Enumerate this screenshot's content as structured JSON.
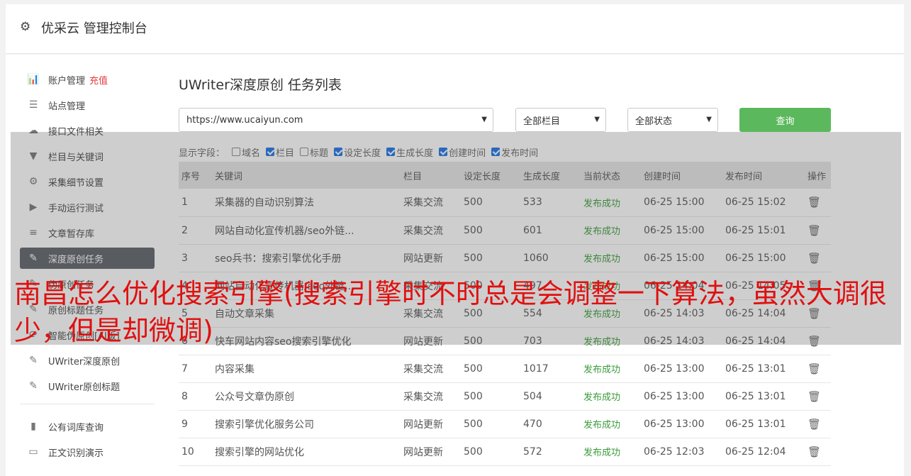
{
  "header": {
    "title": "优采云 管理控制台"
  },
  "sidebar": {
    "items": [
      {
        "label": "账户管理",
        "extra": "充值",
        "icon": "bar-chart-icon"
      },
      {
        "label": "站点管理",
        "icon": "server-icon"
      },
      {
        "label": "接口文件相关",
        "icon": "cloud-upload-icon"
      },
      {
        "label": "栏目与关键词",
        "icon": "filter-icon"
      },
      {
        "label": "采集细节设置",
        "icon": "cogs-icon"
      },
      {
        "label": "手动运行测试",
        "icon": "play-circle-icon"
      },
      {
        "label": "文章暂存库",
        "icon": "database-icon"
      },
      {
        "label": "深度原创任务",
        "icon": "edit-icon",
        "active": true
      },
      {
        "label": "伪原创任务",
        "icon": "edit-icon"
      },
      {
        "label": "原创标题任务",
        "icon": "edit-icon"
      },
      {
        "label": "智能伪原创[AI版]",
        "icon": "refresh-icon"
      },
      {
        "label": "UWriter深度原创",
        "icon": "edit-icon"
      },
      {
        "label": "UWriter原创标题",
        "icon": "edit-icon"
      }
    ],
    "bottom_items": [
      {
        "label": "公有词库查询",
        "icon": "book-icon"
      },
      {
        "label": "正文识别演示",
        "icon": "monitor-icon"
      }
    ]
  },
  "main": {
    "title": "UWriter深度原创 任务列表",
    "site_select": "https://www.ucaiyun.com",
    "column_select": "全部栏目",
    "status_select": "全部状态",
    "query_label": "查询",
    "fields_label": "显示字段：",
    "fields": [
      {
        "label": "域名",
        "checked": false
      },
      {
        "label": "栏目",
        "checked": true
      },
      {
        "label": "标题",
        "checked": false
      },
      {
        "label": "设定长度",
        "checked": true
      },
      {
        "label": "生成长度",
        "checked": true
      },
      {
        "label": "创建时间",
        "checked": true
      },
      {
        "label": "发布时间",
        "checked": true
      }
    ],
    "table": {
      "headers": [
        "序号",
        "关键词",
        "栏目",
        "设定长度",
        "生成长度",
        "当前状态",
        "创建时间",
        "发布时间",
        "操作"
      ],
      "rows": [
        [
          "1",
          "采集器的自动识别算法",
          "采集交流",
          "500",
          "533",
          "发布成功",
          "06-25 15:00",
          "06-25 15:02"
        ],
        [
          "2",
          "网站自动化宣传机器/seo外链...",
          "采集交流",
          "500",
          "601",
          "发布成功",
          "06-25 15:00",
          "06-25 15:01"
        ],
        [
          "3",
          "seo兵书：搜索引擎优化手册",
          "网站更新",
          "500",
          "1060",
          "发布成功",
          "06-25 15:00",
          "06-25 15:00"
        ],
        [
          "4",
          "网站自动化宣传机器/seo外链...",
          "采集交流",
          "500",
          "497",
          "发布成功",
          "06-25 14:04",
          "06-25 14:05"
        ],
        [
          "5",
          "自动文章采集",
          "采集交流",
          "500",
          "554",
          "发布成功",
          "06-25 14:03",
          "06-25 14:04"
        ],
        [
          "6",
          "快车网站内容seo搜索引擎优化",
          "网站更新",
          "500",
          "703",
          "发布成功",
          "06-25 14:03",
          "06-25 14:04"
        ],
        [
          "7",
          "内容采集",
          "采集交流",
          "500",
          "1017",
          "发布成功",
          "06-25 13:00",
          "06-25 13:01"
        ],
        [
          "8",
          "公众号文章伪原创",
          "采集交流",
          "500",
          "504",
          "发布成功",
          "06-25 13:00",
          "06-25 13:01"
        ],
        [
          "9",
          "搜索引擎优化服务公司",
          "网站更新",
          "500",
          "470",
          "发布成功",
          "06-25 13:00",
          "06-25 13:01"
        ],
        [
          "10",
          "搜索引擎的网站优化",
          "网站更新",
          "500",
          "572",
          "发布成功",
          "06-25 12:03",
          "06-25 12:04"
        ]
      ]
    }
  },
  "overlay": {
    "text": "南昌怎么优化搜索引擎(搜索引擎时不时总是会调整一下算法，虽然大调很少，但是却微调)"
  },
  "colors": {
    "accent_green": "#5cb85c",
    "active_bg": "#5c6168",
    "recharge_red": "#e4393c",
    "overlay_red": "#e01010"
  }
}
